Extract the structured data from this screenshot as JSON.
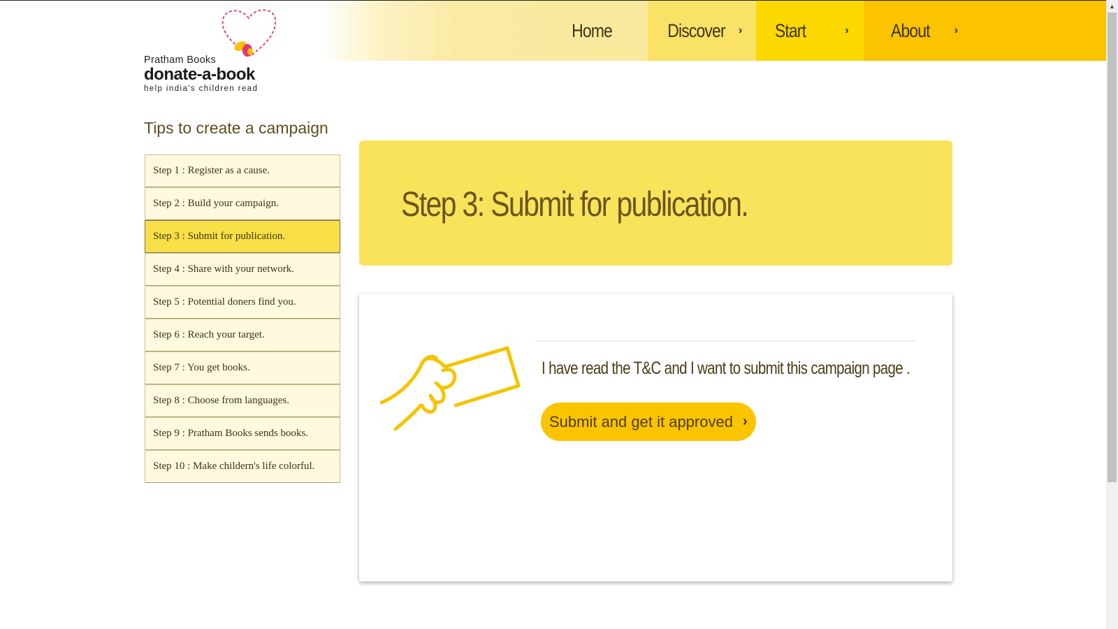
{
  "logo": {
    "brand": "Pratham Books",
    "name": "donate-a-book",
    "tagline": "help india's children read"
  },
  "nav": {
    "home": "Home",
    "discover": "Discover",
    "start": "Start",
    "about": "About",
    "chevron": "›"
  },
  "sidebar": {
    "heading": "Tips to create a campaign",
    "active_index": 2,
    "steps": [
      "Step 1 : Register as a cause.",
      "Step 2 : Build your campaign.",
      "Step 3 : Submit for publication.",
      "Step 4 : Share with your network.",
      "Step 5 : Potential doners find you.",
      "Step 6 : Reach your target.",
      "Step 7 : You get books.",
      "Step 8 : Choose from languages.",
      "Step 9 : Pratham Books sends books.",
      "Step 10 : Make childern's life colorful."
    ]
  },
  "main": {
    "title": "Step 3: Submit for publication.",
    "message": "I have read the T&C and I want to submit this campaign page .",
    "submit_label": "Submit and get it approved",
    "submit_chevron": "›"
  },
  "colors": {
    "banner": "#f9e35b",
    "button": "#fbc400",
    "active_step": "#f9df48",
    "nav_start": "#fbd800",
    "nav_about": "#fbc300",
    "icon": "#f5c400"
  },
  "icons": [
    "heart-logo-icon",
    "hand-card-icon",
    "chevron-right-icon",
    "scroll-up-arrow-icon"
  ]
}
